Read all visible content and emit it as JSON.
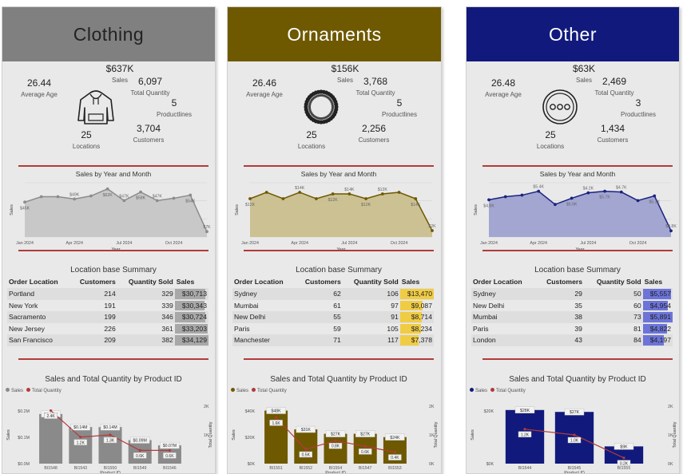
{
  "panels": [
    {
      "title": "Clothing",
      "header_bg": "#808080",
      "header_fg": "#222222",
      "accent": "#8c8c8c",
      "area_fill": "#c4c4c4",
      "bar_color": "#8a8a8a",
      "icon": "hoodie-icon",
      "kpis": {
        "sales": {
          "value": "$637K",
          "label": "Sales"
        },
        "avg_age": {
          "value": "26.44",
          "label": "Average Age"
        },
        "qty": {
          "value": "6,097",
          "label": "Total Quantity"
        },
        "productlines": {
          "value": "5",
          "label": "Productlines"
        },
        "locations": {
          "value": "25",
          "label": "Locations"
        },
        "customers": {
          "value": "3,704",
          "label": "Customers"
        }
      },
      "line_chart": {
        "title": "Sales by Year and Month",
        "x_label": "Year",
        "y_label": "Sales",
        "x_ticks": [
          "Jan 2024",
          "Apr 2024",
          "Jul 2024",
          "Oct 2024"
        ],
        "data_labels": [
          "$45K",
          "$49K",
          "$62K",
          "$47K",
          "$58K",
          "$47K",
          "$54K",
          "$7K"
        ]
      },
      "table": {
        "title": "Location base Summary",
        "headers": [
          "Order Location",
          "Customers",
          "Quantity Sold",
          "Sales"
        ],
        "rows": [
          [
            "Portland",
            "214",
            "329",
            "$30,713"
          ],
          [
            "New York",
            "191",
            "339",
            "$30,343"
          ],
          [
            "Sacramento",
            "199",
            "346",
            "$30,724"
          ],
          [
            "New Jersey",
            "226",
            "361",
            "$33,203"
          ],
          [
            "San Francisco",
            "209",
            "382",
            "$34,129"
          ]
        ]
      },
      "combo_chart": {
        "title": "Sales and Total Quantity by Product ID",
        "legend": [
          "Sales",
          "Total Quantity"
        ],
        "x_label": "Product ID",
        "y_left_label": "Sales",
        "y_right_label": "Total Quantity",
        "y_left_ticks": [
          "$0.2M",
          "$0.1M",
          "$0.0M"
        ],
        "y_right_ticks": [
          "2K",
          "1K"
        ],
        "categories": [
          "BI1548",
          "BI1543",
          "BI1550",
          "BI1549",
          "BI1546"
        ],
        "sales_labels": [
          "$0.19M",
          "$0.14M",
          "$0.14M",
          "$0.09M",
          "$0.07M"
        ],
        "qty_labels": [
          "2.4K",
          "1.2K",
          "1.3K",
          "0.6K",
          "0.6K"
        ]
      }
    },
    {
      "title": "Ornaments",
      "header_bg": "#6e5900",
      "header_fg": "#ffffff",
      "accent": "#6e5900",
      "area_fill": "#c9bd8a",
      "bar_color": "#6e5900",
      "icon": "bead-ring-icon",
      "kpis": {
        "sales": {
          "value": "$156K",
          "label": "Sales"
        },
        "avg_age": {
          "value": "26.46",
          "label": "Average Age"
        },
        "qty": {
          "value": "3,768",
          "label": "Total Quantity"
        },
        "productlines": {
          "value": "5",
          "label": "Productlines"
        },
        "locations": {
          "value": "25",
          "label": "Locations"
        },
        "customers": {
          "value": "2,256",
          "label": "Customers"
        }
      },
      "line_chart": {
        "title": "Sales by Year and Month",
        "x_label": "Year",
        "y_label": "Sales",
        "x_ticks": [
          "Jan 2024",
          "Apr 2024",
          "Jul 2024",
          "Oct 2024"
        ],
        "data_labels": [
          "$12K",
          "$14K",
          "$12K",
          "$14K",
          "$12K",
          "$12K",
          "$14K",
          "$2K"
        ]
      },
      "table": {
        "title": "Location base Summary",
        "headers": [
          "Order Location",
          "Customers",
          "Quantity Sold",
          "Sales"
        ],
        "rows": [
          [
            "Sydney",
            "62",
            "106",
            "$13,470"
          ],
          [
            "Mumbai",
            "61",
            "97",
            "$9,087"
          ],
          [
            "New Delhi",
            "55",
            "91",
            "$8,714"
          ],
          [
            "Paris",
            "59",
            "105",
            "$8,234"
          ],
          [
            "Manchester",
            "71",
            "117",
            "$7,378"
          ]
        ]
      },
      "combo_chart": {
        "title": "Sales and Total Quantity by Product ID",
        "legend": [
          "Sales",
          "Total Quantity"
        ],
        "x_label": "Product ID",
        "y_left_label": "Sales",
        "y_right_label": "Total Quantity",
        "y_left_ticks": [
          "$40K",
          "$20K",
          "$0K"
        ],
        "y_right_ticks": [
          "2K",
          "1K",
          "0K"
        ],
        "categories": [
          "BI1551",
          "BI1552",
          "BI1554",
          "BI1547",
          "BI1553"
        ],
        "sales_labels": [
          "$48K",
          "$31K",
          "$27K",
          "$27K",
          "$24K"
        ],
        "qty_labels": [
          "1.6K",
          "0.5K",
          "0.8K",
          "0.6K",
          "0.4K"
        ]
      }
    },
    {
      "title": "Other",
      "header_bg": "#111a7c",
      "header_fg": "#ffffff",
      "accent": "#1b237f",
      "area_fill": "#9a9fce",
      "bar_color": "#111a7c",
      "icon": "button-icon",
      "kpis": {
        "sales": {
          "value": "$63K",
          "label": "Sales"
        },
        "avg_age": {
          "value": "26.48",
          "label": "Average Age"
        },
        "qty": {
          "value": "2,469",
          "label": "Total Quantity"
        },
        "productlines": {
          "value": "3",
          "label": "Productlines"
        },
        "locations": {
          "value": "25",
          "label": "Locations"
        },
        "customers": {
          "value": "1,434",
          "label": "Customers"
        }
      },
      "line_chart": {
        "title": "Sales by Year and Month",
        "x_label": "Year",
        "y_label": "Sales",
        "x_ticks": [
          "Jan 2024",
          "Apr 2024",
          "Jul 2024",
          "Oct 2024"
        ],
        "data_labels": [
          "$4.8K",
          "$5.4K",
          "$5.9K",
          "$4.2K",
          "$5.7K",
          "$4.7K",
          "$5.3K",
          "$0.8K"
        ]
      },
      "table": {
        "title": "Location base Summary",
        "headers": [
          "Order Location",
          "Customers",
          "Quantity Sold",
          "Sales"
        ],
        "rows": [
          [
            "Sydney",
            "29",
            "50",
            "$5,557"
          ],
          [
            "New Delhi",
            "35",
            "60",
            "$4,954"
          ],
          [
            "Mumbai",
            "38",
            "73",
            "$5,891"
          ],
          [
            "Paris",
            "39",
            "81",
            "$4,822"
          ],
          [
            "London",
            "43",
            "84",
            "$4,197"
          ]
        ]
      },
      "combo_chart": {
        "title": "Sales and Total Quantity by Product ID",
        "legend": [
          "Sales",
          "Total Quantity"
        ],
        "x_label": "Product ID",
        "y_left_label": "Sales",
        "y_right_label": "Total Quantity",
        "y_left_ticks": [
          "$20K",
          "$0K"
        ],
        "y_right_ticks": [
          "2K",
          "1K",
          "0K"
        ],
        "categories": [
          "BI1544",
          "BI1545",
          "BI1555"
        ],
        "sales_labels": [
          "$28K",
          "$27K",
          "$9K"
        ],
        "qty_labels": [
          "1.2K",
          "1.0K",
          "0.2K"
        ]
      }
    }
  ],
  "chart_data": [
    {
      "type": "area",
      "title": "Sales by Year and Month",
      "panel": "Clothing",
      "x": [
        "Jan 2024",
        "Feb 2024",
        "Mar 2024",
        "Apr 2024",
        "May 2024",
        "Jun 2024",
        "Jul 2024",
        "Aug 2024",
        "Sep 2024",
        "Oct 2024",
        "Nov 2024",
        "Dec 2024"
      ],
      "values": [
        45000,
        52000,
        52000,
        49000,
        53000,
        62000,
        47000,
        58000,
        47000,
        50000,
        54000,
        7000
      ],
      "ylim": [
        0,
        70000
      ]
    },
    {
      "type": "area",
      "title": "Sales by Year and Month",
      "panel": "Ornaments",
      "x": [
        "Jan 2024",
        "Feb 2024",
        "Mar 2024",
        "Apr 2024",
        "May 2024",
        "Jun 2024",
        "Jul 2024",
        "Aug 2024",
        "Sep 2024",
        "Oct 2024",
        "Nov 2024",
        "Dec 2024"
      ],
      "values": [
        12000,
        14000,
        12000,
        14000,
        12000,
        13500,
        13500,
        12000,
        13500,
        14000,
        12000,
        2000
      ],
      "ylim": [
        0,
        17000
      ]
    },
    {
      "type": "area",
      "title": "Sales by Year and Month",
      "panel": "Other",
      "x": [
        "Jan 2024",
        "Feb 2024",
        "Mar 2024",
        "Apr 2024",
        "May 2024",
        "Jun 2024",
        "Jul 2024",
        "Aug 2024",
        "Sep 2024",
        "Oct 2024",
        "Nov 2024",
        "Dec 2024"
      ],
      "values": [
        4800,
        5200,
        5400,
        5900,
        4200,
        5000,
        5700,
        5900,
        5800,
        4700,
        5300,
        800
      ],
      "ylim": [
        0,
        7000
      ]
    },
    {
      "type": "bar",
      "title": "Sales and Total Quantity by Product ID",
      "panel": "Clothing",
      "categories": [
        "BI1548",
        "BI1543",
        "BI1550",
        "BI1549",
        "BI1546"
      ],
      "series": [
        {
          "name": "Sales",
          "values": [
            190000,
            140000,
            140000,
            90000,
            70000
          ]
        },
        {
          "name": "Total Quantity",
          "values": [
            2400,
            1200,
            1300,
            600,
            600
          ]
        }
      ],
      "ylim": [
        0,
        220000
      ],
      "y2lim": [
        0,
        2600
      ]
    },
    {
      "type": "bar",
      "title": "Sales and Total Quantity by Product ID",
      "panel": "Ornaments",
      "categories": [
        "BI1551",
        "BI1552",
        "BI1554",
        "BI1547",
        "BI1553"
      ],
      "series": [
        {
          "name": "Sales",
          "values": [
            48000,
            31000,
            27000,
            27000,
            24000
          ]
        },
        {
          "name": "Total Quantity",
          "values": [
            1600,
            500,
            800,
            600,
            400
          ]
        }
      ],
      "ylim": [
        0,
        52000
      ],
      "y2lim": [
        0,
        2000
      ]
    },
    {
      "type": "bar",
      "title": "Sales and Total Quantity by Product ID",
      "panel": "Other",
      "categories": [
        "BI1544",
        "BI1545",
        "BI1555"
      ],
      "series": [
        {
          "name": "Sales",
          "values": [
            28000,
            27000,
            9000
          ]
        },
        {
          "name": "Total Quantity",
          "values": [
            1200,
            1000,
            200
          ]
        }
      ],
      "ylim": [
        0,
        30000
      ],
      "y2lim": [
        0,
        2000
      ]
    }
  ]
}
